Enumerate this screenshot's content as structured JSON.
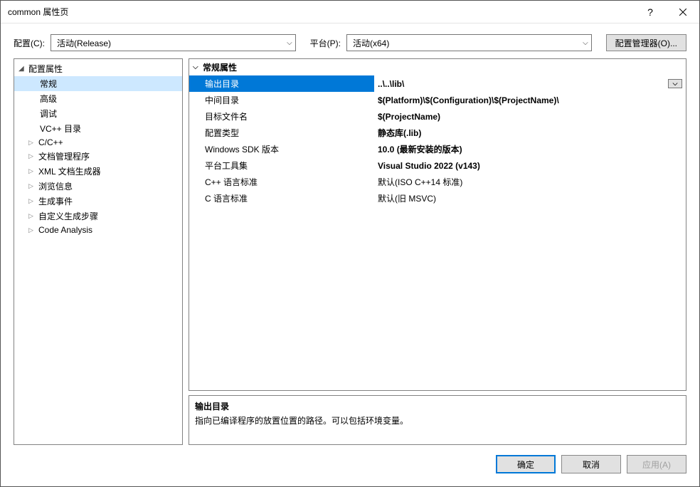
{
  "title": "common 属性页",
  "toolbar": {
    "config_label": "配置(C):",
    "config_value": "活动(Release)",
    "platform_label": "平台(P):",
    "platform_value": "活动(x64)",
    "manager_btn": "配置管理器(O)..."
  },
  "tree": {
    "root": "配置属性",
    "items": [
      {
        "label": "常规",
        "selected": true
      },
      {
        "label": "高级"
      },
      {
        "label": "调试"
      },
      {
        "label": "VC++ 目录"
      },
      {
        "label": "C/C++",
        "expandable": true
      },
      {
        "label": "文档管理程序",
        "expandable": true
      },
      {
        "label": "XML 文档生成器",
        "expandable": true
      },
      {
        "label": "浏览信息",
        "expandable": true
      },
      {
        "label": "生成事件",
        "expandable": true
      },
      {
        "label": "自定义生成步骤",
        "expandable": true
      },
      {
        "label": "Code Analysis",
        "expandable": true
      }
    ]
  },
  "grid": {
    "section": "常规属性",
    "rows": [
      {
        "name": "输出目录",
        "value": "..\\..\\lib\\",
        "selected": true,
        "bold": true,
        "dropdown": true
      },
      {
        "name": "中间目录",
        "value": "$(Platform)\\$(Configuration)\\$(ProjectName)\\",
        "bold": true
      },
      {
        "name": "目标文件名",
        "value": "$(ProjectName)",
        "bold": true
      },
      {
        "name": "配置类型",
        "value": "静态库(.lib)",
        "bold": true
      },
      {
        "name": "Windows SDK 版本",
        "value": "10.0 (最新安装的版本)",
        "bold": true
      },
      {
        "name": "平台工具集",
        "value": "Visual Studio 2022 (v143)",
        "bold": true
      },
      {
        "name": "C++ 语言标准",
        "value": "默认(ISO C++14 标准)",
        "bold": false
      },
      {
        "name": "C 语言标准",
        "value": "默认(旧 MSVC)",
        "bold": false
      }
    ]
  },
  "description": {
    "title": "输出目录",
    "text": "指向已编译程序的放置位置的路径。可以包括环境变量。"
  },
  "footer": {
    "ok": "确定",
    "cancel": "取消",
    "apply": "应用(A)"
  }
}
